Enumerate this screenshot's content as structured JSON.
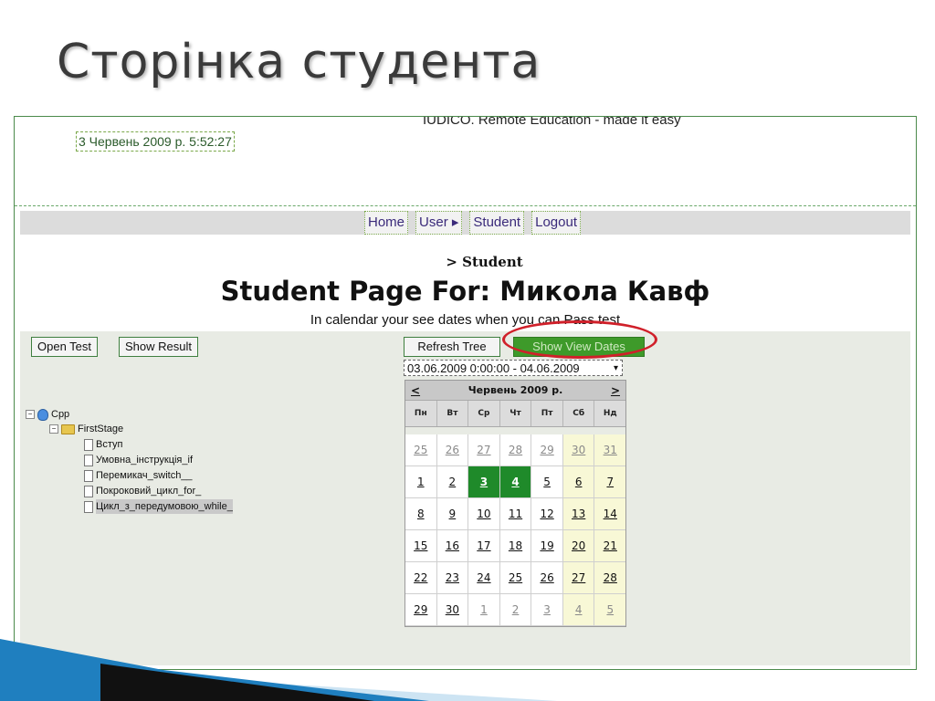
{
  "slide": {
    "title": "Сторінка студента"
  },
  "app": {
    "tagline": "IUDICO. Remote Education - made it easy",
    "datetime": "3 Червень 2009 р. 5:52:27"
  },
  "nav": {
    "home": "Home",
    "user": "User",
    "user_arrow": "▸",
    "student": "Student",
    "logout": "Logout"
  },
  "page": {
    "breadcrumb": "> Student",
    "heading": "Student Page For: Микола Кавф",
    "subheading": "In calendar your see dates when you can Pass test"
  },
  "buttons": {
    "open_test": "Open Test",
    "show_result": "Show Result",
    "refresh_tree": "Refresh Tree",
    "show_view_dates": "Show View Dates"
  },
  "date_range": {
    "value": "03.06.2009 0:00:00 - 04.06.2009 0:00:00",
    "arrow": "▾"
  },
  "calendar": {
    "prev": "<",
    "next": ">",
    "month_title": "Червень 2009 р.",
    "weekdays": [
      "Пн",
      "Вт",
      "Ср",
      "Чт",
      "Пт",
      "Сб",
      "Нд"
    ],
    "weeks": [
      [
        "25",
        "26",
        "27",
        "28",
        "29",
        "30",
        "31"
      ],
      [
        "1",
        "2",
        "3",
        "4",
        "5",
        "6",
        "7"
      ],
      [
        "8",
        "9",
        "10",
        "11",
        "12",
        "13",
        "14"
      ],
      [
        "15",
        "16",
        "17",
        "18",
        "19",
        "20",
        "21"
      ],
      [
        "22",
        "23",
        "24",
        "25",
        "26",
        "27",
        "28"
      ],
      [
        "29",
        "30",
        "1",
        "2",
        "3",
        "4",
        "5"
      ]
    ],
    "selected_days": [
      "3",
      "4"
    ]
  },
  "tree": {
    "root": {
      "label": "Cpp",
      "toggle": "−"
    },
    "stage": {
      "label": "FirstStage",
      "toggle": "−"
    },
    "items": [
      {
        "label": "Вступ"
      },
      {
        "label": "Умовна_інструкція_if"
      },
      {
        "label": "Перемикач_switch__"
      },
      {
        "label": "Покроковий_цикл_for_"
      },
      {
        "label": "Цикл_з_передумовою_while_",
        "highlighted": true
      }
    ]
  },
  "colors": {
    "border_green": "#4b8a4b",
    "selected_day": "#1f8a2a",
    "annotation_red": "#d0202a",
    "accent_blue": "#1f7fbf"
  }
}
